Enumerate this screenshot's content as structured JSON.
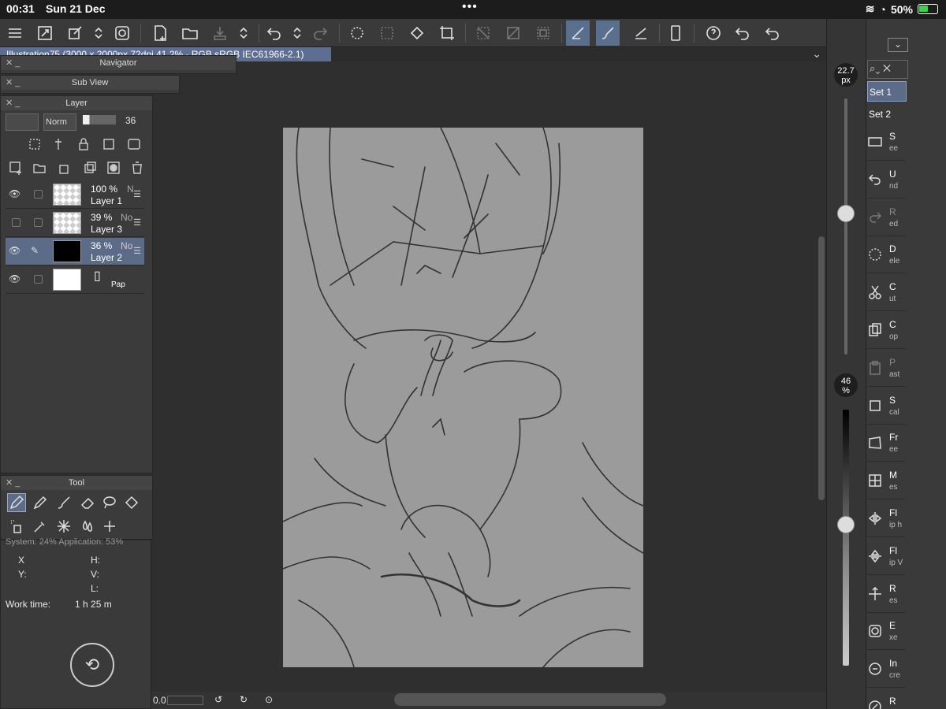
{
  "status": {
    "time": "00:31",
    "date": "Sun 21 Dec",
    "battery": "50%",
    "dots": "•••"
  },
  "document": {
    "title": "Illustration75 (3000 x 2000px 72dpi 41.2% - RGB sRGB IEC61966-2.1)"
  },
  "panels": {
    "navigator": {
      "title": "Navigator"
    },
    "subview": {
      "title": "Sub View"
    },
    "layer": {
      "title": "Layer",
      "blend_mode": "Norm",
      "opacity": "36",
      "layers": [
        {
          "pct": "100 %",
          "mode": "N",
          "name": "Layer 1"
        },
        {
          "pct": "39 %",
          "mode": "No",
          "name": "Layer 3"
        },
        {
          "pct": "36 %",
          "mode": "No",
          "name": "Layer 2"
        },
        {
          "pct": "",
          "mode": "",
          "name": "Pap"
        }
      ]
    },
    "tool": {
      "title": "Tool"
    },
    "info": {
      "sys_line": "System: 24%   Application: 53%",
      "x_label": "X",
      "y_label": "Y:",
      "h_label": "H:",
      "v_label": "V:",
      "l_label": "L:",
      "worktime_label": "Work time:",
      "worktime_value": "1 h 25 m"
    }
  },
  "right_strip": {
    "brush_size": "22.7",
    "brush_unit": "px",
    "opacity": "46",
    "opacity_unit": "%",
    "brush_size_level": 0.55,
    "opacity_level": 0.55
  },
  "command_bar": {
    "sets": [
      "Set 1",
      "Set 2"
    ],
    "commands": [
      {
        "a": "S",
        "b": "ee",
        "icon": "new-icon"
      },
      {
        "a": "U",
        "b": "nd",
        "icon": "undo-icon"
      },
      {
        "a": "R",
        "b": "ed",
        "icon": "redo-icon"
      },
      {
        "a": "D",
        "b": "ele",
        "icon": "deselect-icon"
      },
      {
        "a": "C",
        "b": "ut",
        "icon": "scissors-icon"
      },
      {
        "a": "C",
        "b": "op",
        "icon": "copy-icon"
      },
      {
        "a": "P",
        "b": "ast",
        "icon": "paste-icon"
      },
      {
        "a": "S",
        "b": "cal",
        "icon": "scale-icon"
      },
      {
        "a": "Fr",
        "b": "ee",
        "icon": "free-transform-icon"
      },
      {
        "a": "M",
        "b": "es",
        "icon": "mesh-icon"
      },
      {
        "a": "Fl",
        "b": "ip h",
        "icon": "flip-horizontal-icon"
      },
      {
        "a": "Fl",
        "b": "ip V",
        "icon": "flip-vertical-icon"
      },
      {
        "a": "R",
        "b": "es",
        "icon": "resize-icon"
      },
      {
        "a": "E",
        "b": "xe",
        "icon": "execute-icon"
      },
      {
        "a": "In",
        "b": "cre",
        "icon": "increase-icon"
      },
      {
        "a": "R",
        "b": "ed",
        "icon": "reduce-icon"
      }
    ]
  },
  "bottom": {
    "zoom": "0.0"
  }
}
